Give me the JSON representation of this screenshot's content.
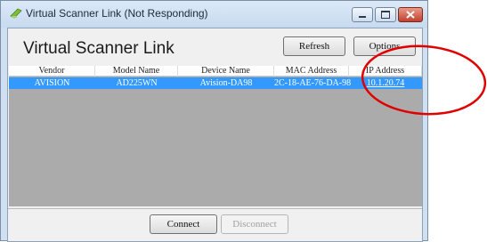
{
  "window": {
    "title": "Virtual Scanner Link (Not Responding)"
  },
  "header": {
    "app_title": "Virtual Scanner Link",
    "refresh_label": "Refresh",
    "options_label": "Options"
  },
  "table": {
    "columns": [
      "Vendor",
      "Model Name",
      "Device Name",
      "MAC Address",
      "IP Address"
    ],
    "rows": [
      {
        "vendor": "AVISION",
        "model": "AD225WN",
        "device": "Avision-DA98",
        "mac": "2C-18-AE-76-DA-98",
        "ip": "10.1.20.74"
      }
    ]
  },
  "footer": {
    "connect_label": "Connect",
    "disconnect_label": "Disconnect"
  },
  "colors": {
    "selection": "#3399ff",
    "annotation": "#e00000"
  }
}
